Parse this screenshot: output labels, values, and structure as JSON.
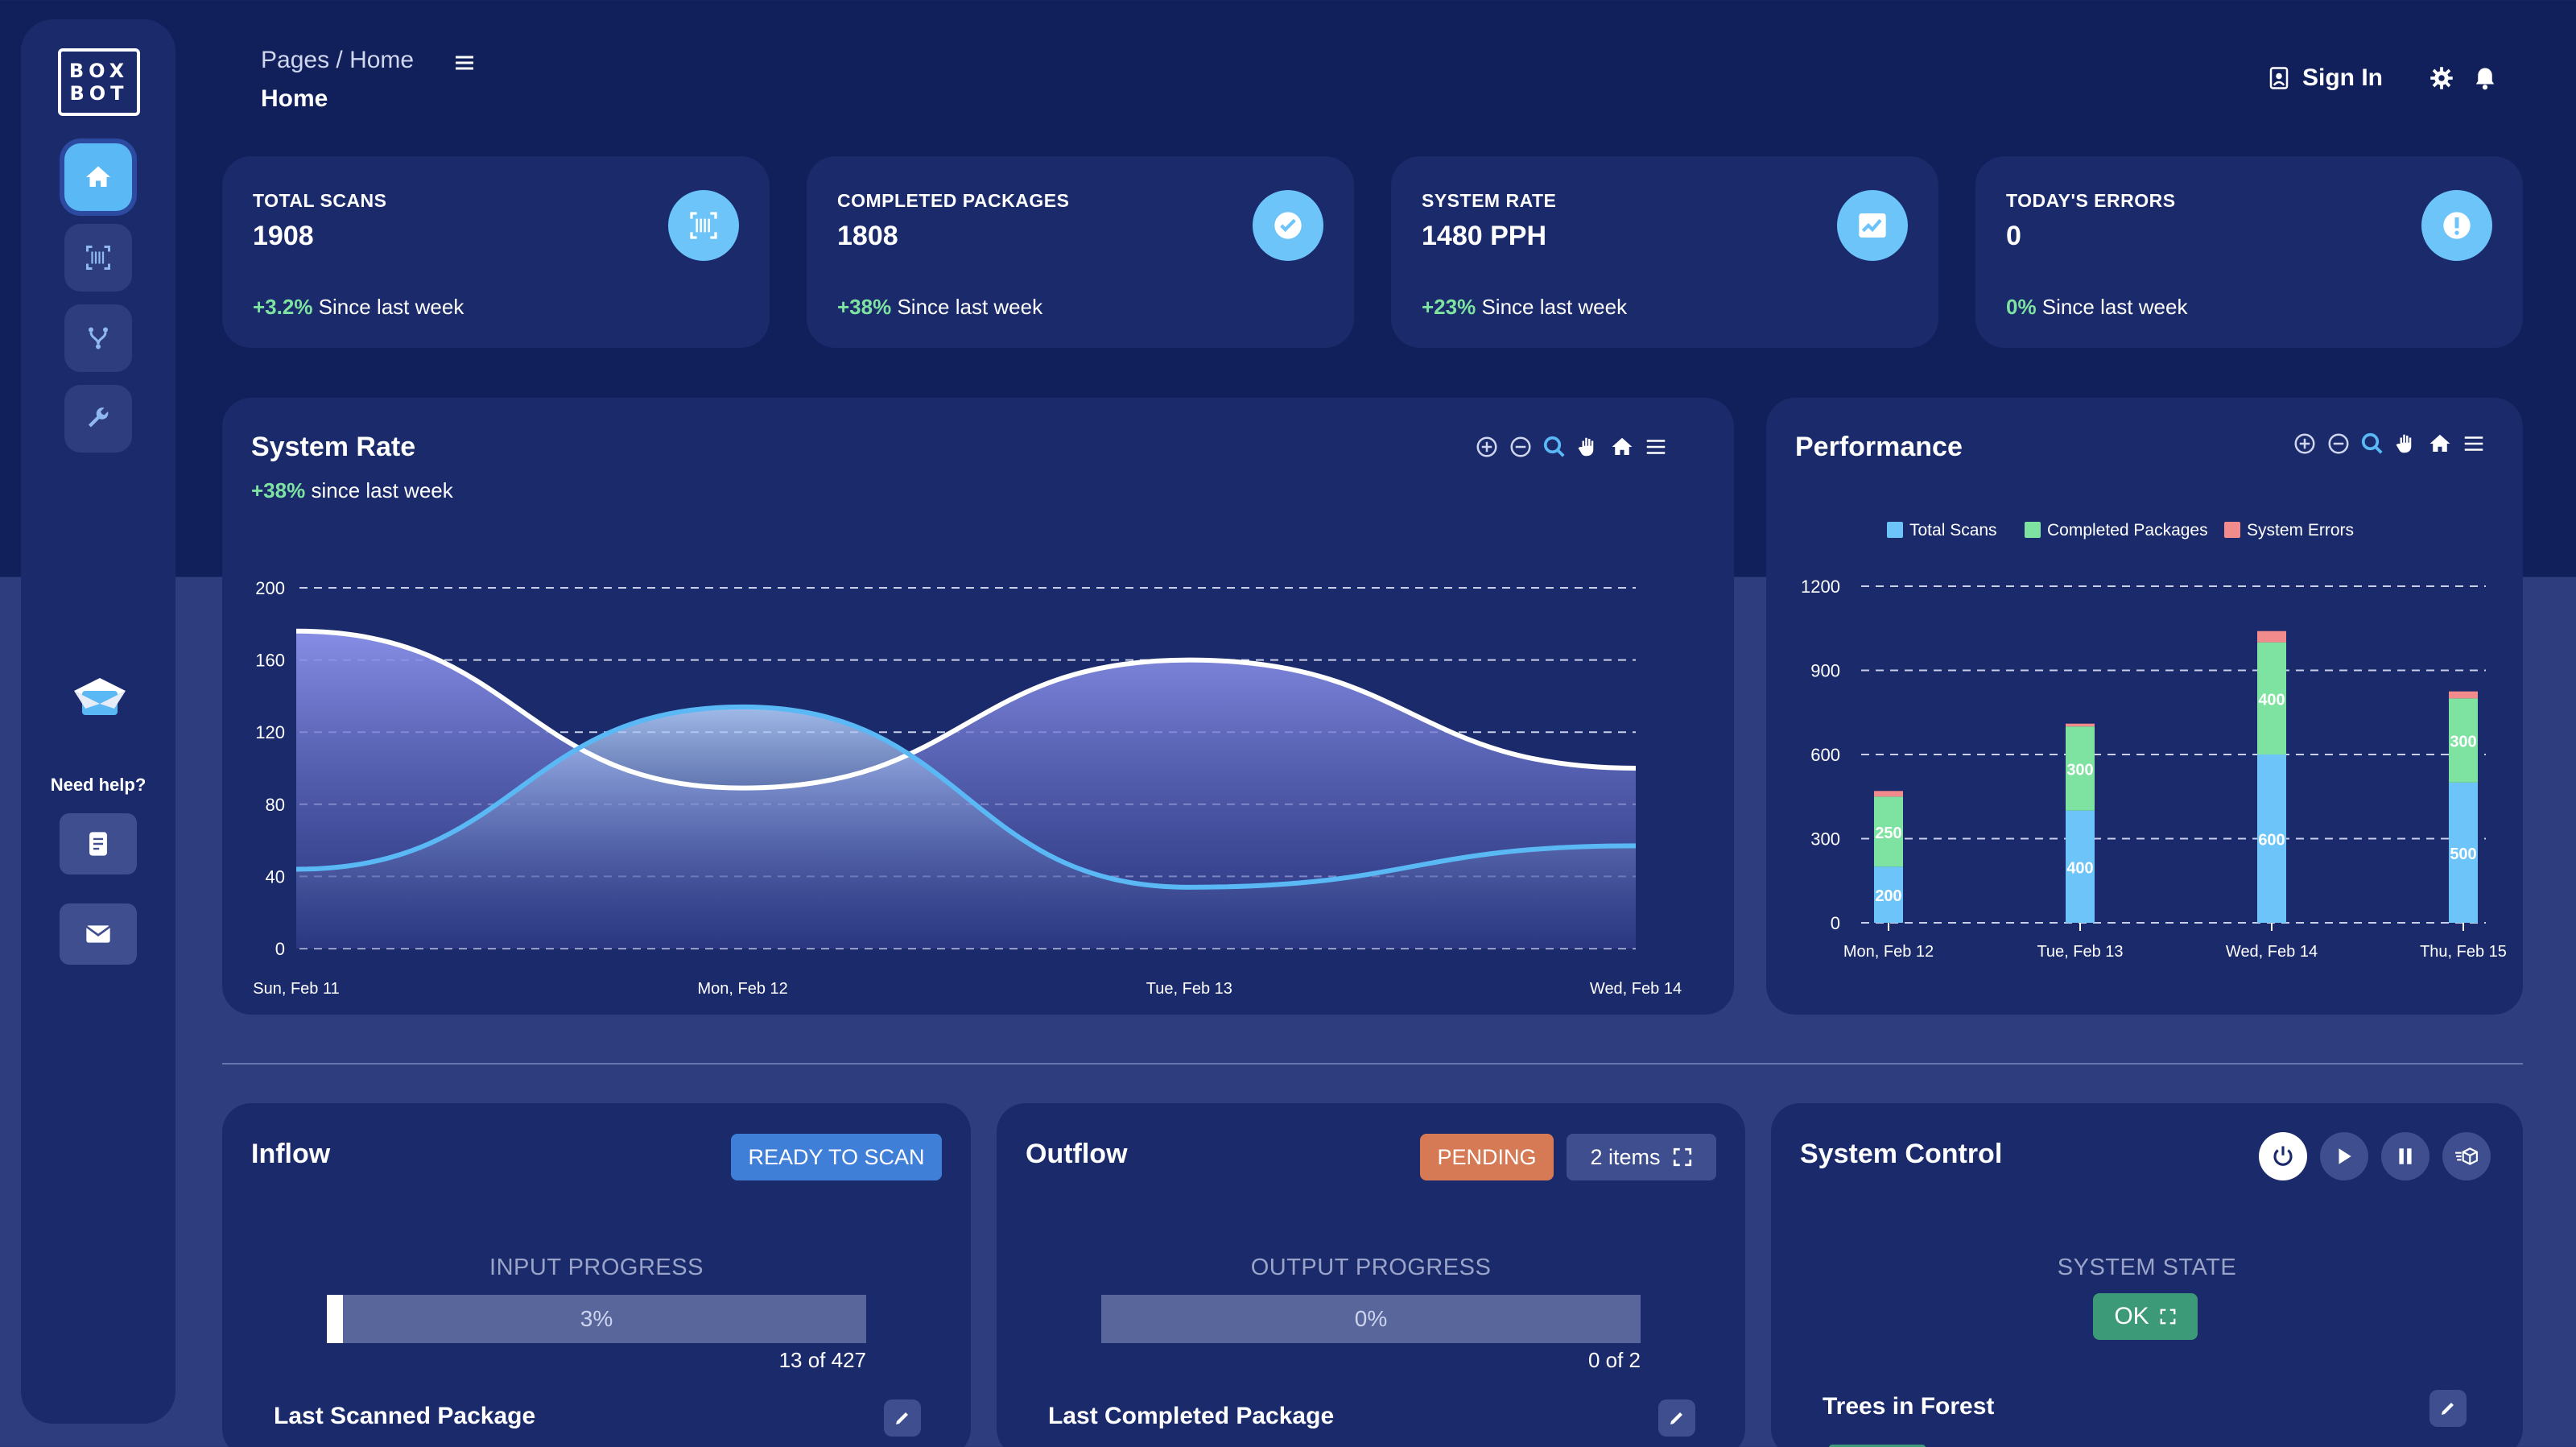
{
  "sidebar": {
    "logo_line1": "BOX",
    "logo_line2": "BOT",
    "help_text": "Need help?"
  },
  "header": {
    "breadcrumb": "Pages  /  Home",
    "title": "Home",
    "signin": "Sign In"
  },
  "stats": [
    {
      "label": "TOTAL SCANS",
      "value": "1908",
      "change": "+3.2%",
      "change_text": " Since last week",
      "icon": "barcode-icon"
    },
    {
      "label": "COMPLETED PACKAGES",
      "value": "1808",
      "change": "+38%",
      "change_text": " Since last week",
      "icon": "check-icon"
    },
    {
      "label": "SYSTEM RATE",
      "value": "1480 PPH",
      "change": "+23%",
      "change_text": " Since last week",
      "icon": "trend-icon"
    },
    {
      "label": "TODAY'S ERRORS",
      "value": "0",
      "change": "0%",
      "change_text": " Since last week",
      "icon": "alert-icon"
    }
  ],
  "system_rate": {
    "title": "System Rate",
    "change": "+38%",
    "change_text": " since last week"
  },
  "performance": {
    "title": "Performance"
  },
  "chart_data": [
    {
      "type": "area",
      "title": "System Rate",
      "categories": [
        "Sun, Feb 11",
        "Mon, Feb 12",
        "Tue, Feb 13",
        "Wed, Feb 14"
      ],
      "ylim": [
        0,
        200
      ],
      "yticks": [
        0,
        40,
        80,
        120,
        160,
        200
      ],
      "grid": true,
      "series": [
        {
          "values": [
            176,
            89,
            160,
            100
          ],
          "color": "#ffffff"
        },
        {
          "values": [
            44,
            134,
            34,
            57
          ],
          "color": "#5ab8f5"
        }
      ]
    },
    {
      "type": "bar",
      "title": "Performance",
      "stacked": true,
      "categories": [
        "Mon, Feb 12",
        "Tue, Feb 13",
        "Wed, Feb 14",
        "Thu, Feb 15"
      ],
      "ylim": [
        0,
        1200
      ],
      "yticks": [
        0,
        300,
        600,
        900,
        1200
      ],
      "legend": "top",
      "grid": true,
      "series": [
        {
          "name": "Total Scans",
          "values": [
            200,
            400,
            600,
            500
          ],
          "color": "#6cc4f8"
        },
        {
          "name": "Completed Packages",
          "values": [
            250,
            300,
            400,
            300
          ],
          "color": "#7ee3a0"
        },
        {
          "name": "System Errors",
          "values": [
            20,
            10,
            40,
            25
          ],
          "color": "#f28b8b"
        }
      ]
    }
  ],
  "inflow": {
    "title": "Inflow",
    "badge": "READY TO SCAN",
    "progress_label": "INPUT PROGRESS",
    "progress_fraction": 0.03,
    "progress_text": "3%",
    "count": "13 of 427",
    "last_label": "Last Scanned Package"
  },
  "outflow": {
    "title": "Outflow",
    "badge": "PENDING",
    "items": "2 items",
    "progress_label": "OUTPUT PROGRESS",
    "progress_fraction": 0,
    "progress_text": "0%",
    "count": "0 of 2",
    "last_label": "Last Completed Package"
  },
  "control": {
    "title": "System Control",
    "state_label": "SYSTEM STATE",
    "state_value": "OK",
    "forest_label": "Trees in Forest"
  },
  "colors": {
    "bg_top": "#11205a",
    "panel": "#1a2a6b",
    "accent": "#5ab8f5",
    "positive": "#7ee3a0",
    "ready": "#3f7fd8",
    "pending": "#d67a55",
    "ok": "#3c9a78"
  }
}
